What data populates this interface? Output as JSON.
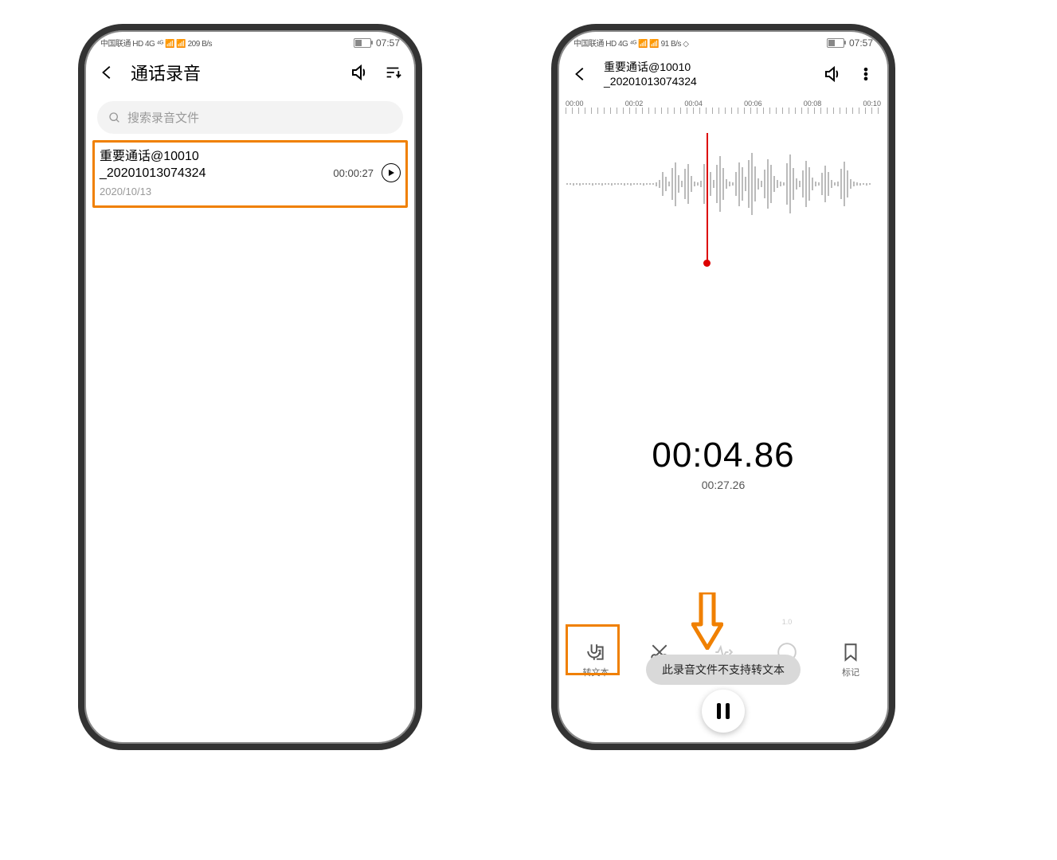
{
  "status": {
    "carrier_line": "中国联通 HD 4G ⁴ᴳ 📶 📶 209 B/s",
    "carrier_line2": "中国联通 HD 4G ⁴ᴳ 📶 📶 91 B/s ◇",
    "time": "07:57"
  },
  "left": {
    "title": "通话录音",
    "search_placeholder": "搜索录音文件",
    "recording": {
      "name_line1": "重要通话@10010",
      "name_line2": "_20201013074324",
      "date": "2020/10/13",
      "duration": "00:00:27"
    }
  },
  "right": {
    "title_line1": "重要通话@10010",
    "title_line2": "_20201013074324",
    "ruler_labels": [
      "00:00",
      "00:02",
      "00:04",
      "00:06",
      "00:08",
      "00:10"
    ],
    "elapsed": "00:04.86",
    "total": "00:27.26",
    "actions": {
      "transcribe": "转文本",
      "trim": "裁剪",
      "skip_silence": "跳过静音",
      "speed": "倍速",
      "speed_value": "1.0",
      "bookmark": "标记"
    },
    "toast": "此录音文件不支持转文本"
  },
  "annotation_color": "#f08000"
}
